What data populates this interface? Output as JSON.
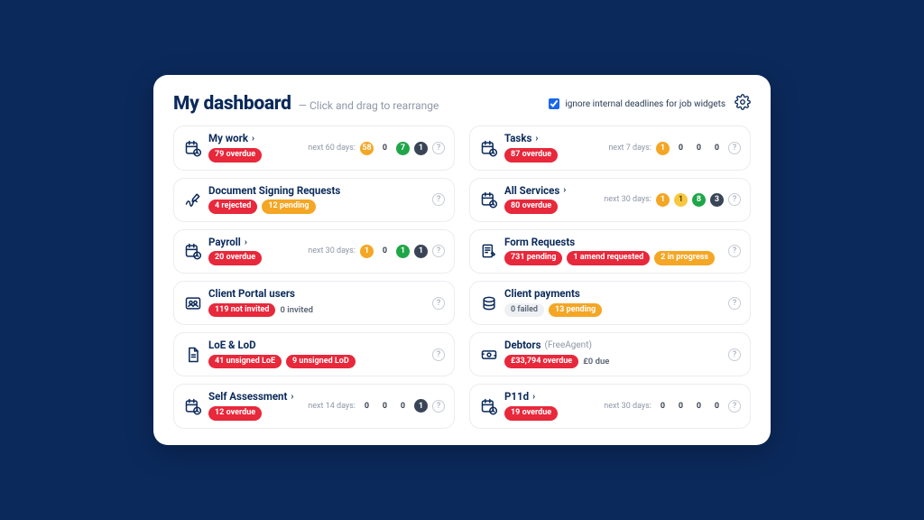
{
  "header": {
    "title": "My dashboard",
    "subtitle": "Click and drag to rearrange",
    "checkbox_label": "ignore internal deadlines for job widgets",
    "checkbox_checked": true
  },
  "help_glyph": "?",
  "widgets": [
    {
      "id": "my-work",
      "icon": "calendar-clock",
      "title": "My work",
      "link": true,
      "pills": [
        {
          "text": "79 overdue",
          "color": "red"
        }
      ],
      "stats": {
        "label": "next 60 days:",
        "chips": [
          {
            "text": "58",
            "style": "orange"
          },
          {
            "text": "0",
            "style": "plain"
          },
          {
            "text": "7",
            "style": "green"
          },
          {
            "text": "1",
            "style": "dark"
          }
        ]
      },
      "help": true
    },
    {
      "id": "tasks",
      "icon": "calendar-clock",
      "title": "Tasks",
      "link": true,
      "pills": [
        {
          "text": "87 overdue",
          "color": "red"
        }
      ],
      "stats": {
        "label": "next 7 days:",
        "chips": [
          {
            "text": "1",
            "style": "orange"
          },
          {
            "text": "0",
            "style": "plain"
          },
          {
            "text": "0",
            "style": "plain"
          },
          {
            "text": "0",
            "style": "plain"
          }
        ]
      },
      "help": true
    },
    {
      "id": "doc-signing",
      "icon": "signature",
      "title": "Document Signing Requests",
      "link": false,
      "pills": [
        {
          "text": "4 rejected",
          "color": "red"
        },
        {
          "text": "12 pending",
          "color": "orange"
        }
      ],
      "help": true
    },
    {
      "id": "all-services",
      "icon": "calendar-clock",
      "title": "All Services",
      "link": true,
      "pills": [
        {
          "text": "80 overdue",
          "color": "red"
        }
      ],
      "stats": {
        "label": "next 30 days:",
        "chips": [
          {
            "text": "1",
            "style": "orange"
          },
          {
            "text": "1",
            "style": "yellow"
          },
          {
            "text": "8",
            "style": "green"
          },
          {
            "text": "3",
            "style": "dark"
          }
        ]
      },
      "help": true
    },
    {
      "id": "payroll",
      "icon": "calendar-clock",
      "title": "Payroll",
      "link": true,
      "pills": [
        {
          "text": "20 overdue",
          "color": "red"
        }
      ],
      "stats": {
        "label": "next 30 days:",
        "chips": [
          {
            "text": "1",
            "style": "orange"
          },
          {
            "text": "0",
            "style": "plain"
          },
          {
            "text": "1",
            "style": "green"
          },
          {
            "text": "1",
            "style": "dark"
          }
        ]
      },
      "help": true
    },
    {
      "id": "form-requests",
      "icon": "form",
      "title": "Form Requests",
      "link": false,
      "pills": [
        {
          "text": "731 pending",
          "color": "red"
        },
        {
          "text": "1 amend requested",
          "color": "red"
        },
        {
          "text": "2 in progress",
          "color": "orange"
        }
      ],
      "help": true
    },
    {
      "id": "client-portal-users",
      "icon": "users",
      "title": "Client Portal users",
      "link": false,
      "pills": [
        {
          "text": "119 not invited",
          "color": "red"
        }
      ],
      "extra_text": "0 invited",
      "help": true
    },
    {
      "id": "client-payments",
      "icon": "coins",
      "title": "Client payments",
      "link": false,
      "pills": [
        {
          "text": "0 failed",
          "color": "gray"
        },
        {
          "text": "13 pending",
          "color": "orange"
        }
      ],
      "help": true
    },
    {
      "id": "loe-lod",
      "icon": "document",
      "title": "LoE & LoD",
      "link": false,
      "pills": [
        {
          "text": "41 unsigned LoE",
          "color": "red"
        },
        {
          "text": "9 unsigned LoD",
          "color": "red"
        }
      ],
      "help": true
    },
    {
      "id": "debtors",
      "icon": "cash",
      "title": "Debtors",
      "title_suffix": "(FreeAgent)",
      "link": false,
      "pills": [
        {
          "text": "£33,794 overdue",
          "color": "red"
        }
      ],
      "extra_text": "£0 due",
      "help": true
    },
    {
      "id": "self-assessment",
      "icon": "calendar-clock",
      "title": "Self Assessment",
      "link": true,
      "pills": [
        {
          "text": "12 overdue",
          "color": "red"
        }
      ],
      "stats": {
        "label": "next 14 days:",
        "chips": [
          {
            "text": "0",
            "style": "plain"
          },
          {
            "text": "0",
            "style": "plain"
          },
          {
            "text": "0",
            "style": "plain"
          },
          {
            "text": "1",
            "style": "dark"
          }
        ]
      },
      "help": true
    },
    {
      "id": "p11d",
      "icon": "calendar-clock",
      "title": "P11d",
      "link": true,
      "pills": [
        {
          "text": "19 overdue",
          "color": "red"
        }
      ],
      "stats": {
        "label": "next 30 days:",
        "chips": [
          {
            "text": "0",
            "style": "plain"
          },
          {
            "text": "0",
            "style": "plain"
          },
          {
            "text": "0",
            "style": "plain"
          },
          {
            "text": "0",
            "style": "plain"
          }
        ]
      },
      "help": true
    }
  ]
}
